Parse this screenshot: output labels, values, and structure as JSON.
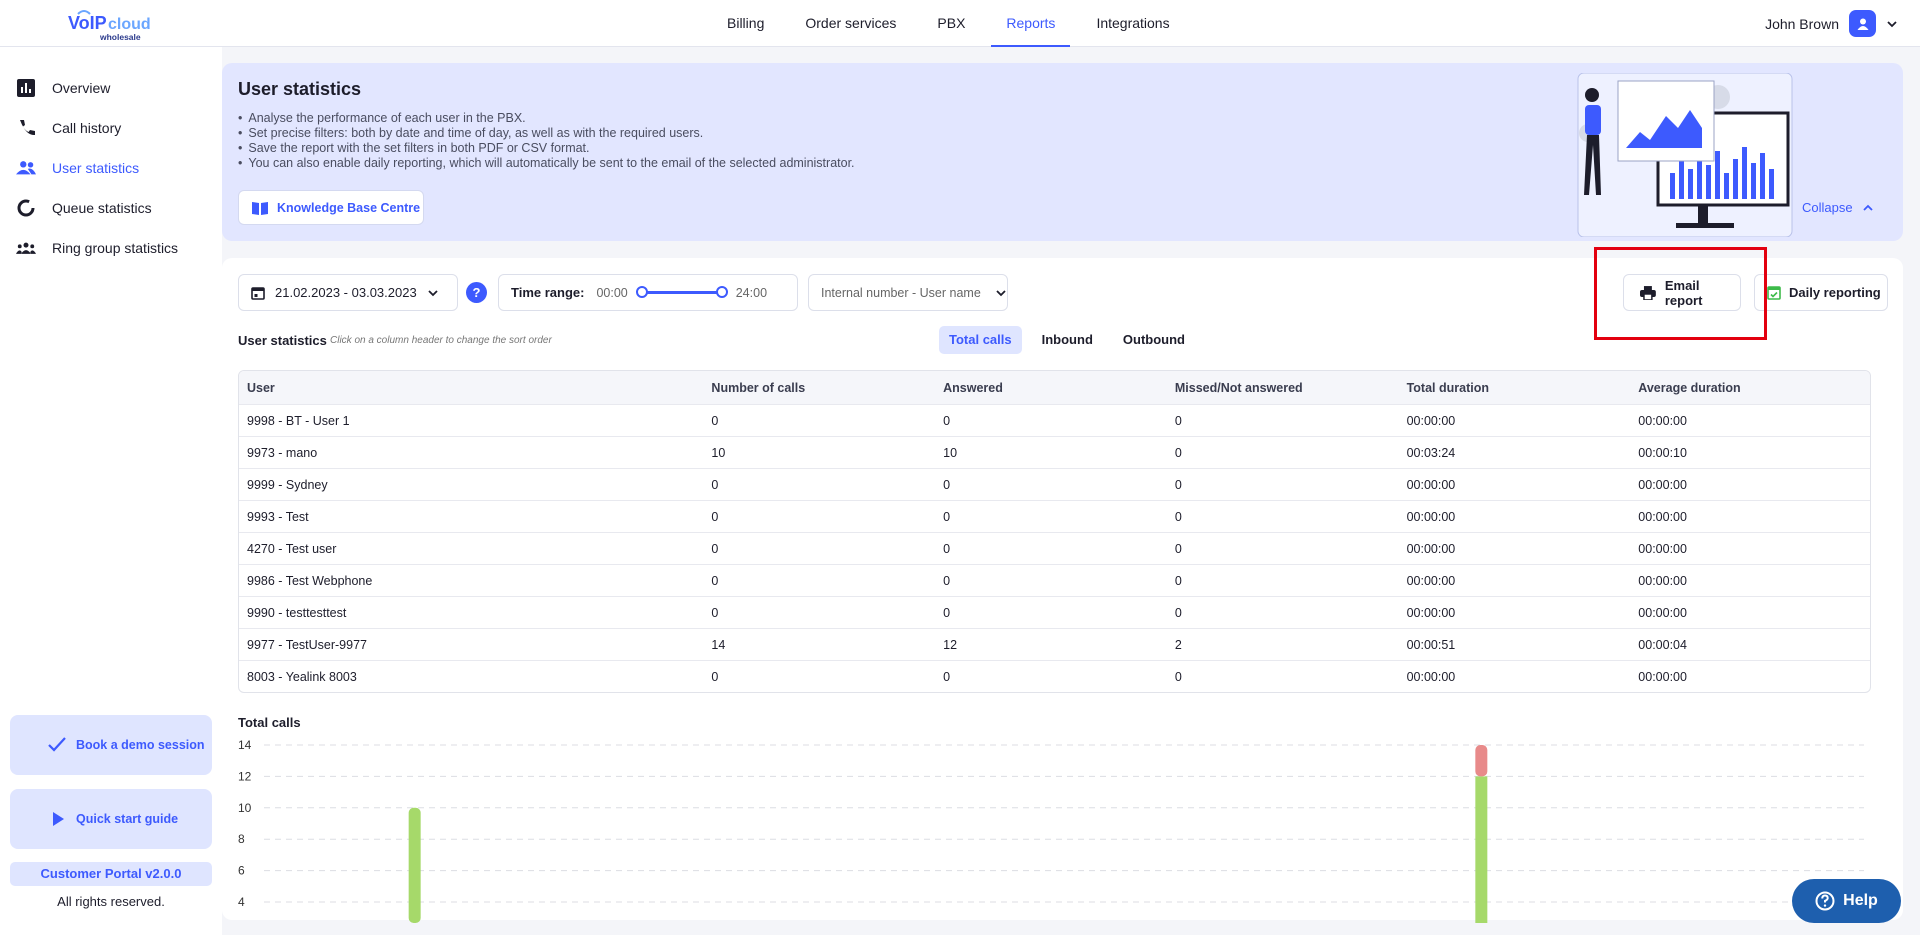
{
  "brand": {
    "logo_main": "VoIPcloud",
    "logo_sub": "wholesale"
  },
  "nav": {
    "items": [
      "Billing",
      "Order services",
      "PBX",
      "Reports",
      "Integrations"
    ],
    "active": "Reports"
  },
  "user": {
    "name": "John Brown"
  },
  "sidebar": {
    "items": [
      {
        "label": "Overview",
        "icon": "bar-chart-icon"
      },
      {
        "label": "Call history",
        "icon": "phone-icon"
      },
      {
        "label": "User statistics",
        "icon": "users-icon",
        "active": true
      },
      {
        "label": "Queue statistics",
        "icon": "donut-icon"
      },
      {
        "label": "Ring group statistics",
        "icon": "group-icon"
      }
    ],
    "demo": "Book a demo session",
    "guide": "Quick start guide",
    "version": "Customer Portal v2.0.0",
    "rights": "All rights reserved."
  },
  "banner": {
    "title": "User statistics",
    "bullets": [
      "Analyse the performance of each user in the PBX.",
      "Set precise filters: both by date and time of day, as well as with the required users.",
      "Save the report with the set filters in both PDF or CSV format.",
      "You can also enable daily reporting, which will automatically be sent to the email of the selected administrator."
    ],
    "kb_button": "Knowledge Base Centre",
    "collapse": "Collapse"
  },
  "filters": {
    "date_range": "21.02.2023 - 03.03.2023",
    "help": "?",
    "time_range_label": "Time range:",
    "time_start": "00:00",
    "time_end": "24:00",
    "user_select": "Internal number - User name",
    "email_report": "Email report",
    "daily_reporting": "Daily reporting"
  },
  "stats": {
    "title": "User statistics",
    "hint": "Click on a column header to change the sort order",
    "tabs": [
      "Total calls",
      "Inbound",
      "Outbound"
    ],
    "active_tab": "Total calls",
    "columns": [
      "User",
      "Number of calls",
      "Answered",
      "Missed/Not answered",
      "Total duration",
      "Average duration"
    ],
    "rows": [
      [
        "9998 - BT - User 1",
        "0",
        "0",
        "0",
        "00:00:00",
        "00:00:00"
      ],
      [
        "9973 - mano",
        "10",
        "10",
        "0",
        "00:03:24",
        "00:00:10"
      ],
      [
        "9999 - Sydney",
        "0",
        "0",
        "0",
        "00:00:00",
        "00:00:00"
      ],
      [
        "9993 - Test",
        "0",
        "0",
        "0",
        "00:00:00",
        "00:00:00"
      ],
      [
        "4270 - Test user",
        "0",
        "0",
        "0",
        "00:00:00",
        "00:00:00"
      ],
      [
        "9986 - Test Webphone",
        "0",
        "0",
        "0",
        "00:00:00",
        "00:00:00"
      ],
      [
        "9990 - testtesttest",
        "0",
        "0",
        "0",
        "00:00:00",
        "00:00:00"
      ],
      [
        "9977 - TestUser-9977",
        "14",
        "12",
        "2",
        "00:00:51",
        "00:00:04"
      ],
      [
        "8003 - Yealink 8003",
        "0",
        "0",
        "0",
        "00:00:00",
        "00:00:00"
      ]
    ]
  },
  "chart_data": {
    "type": "bar",
    "title": "Total calls",
    "categories": [
      "9998 - BT - User 1",
      "9973 - mano",
      "9999 - Sydney",
      "9993 - Test",
      "4270 - Test user",
      "9986 - Test Webphone",
      "9990 - testtesttest",
      "9977 - TestUser-9977",
      "8003 - Yealink 8003"
    ],
    "series": [
      {
        "values": [
          0,
          10,
          0,
          0,
          0,
          0,
          0,
          12,
          0
        ],
        "color": "#a6d96a"
      },
      {
        "values": [
          0,
          0,
          0,
          0,
          0,
          0,
          0,
          2,
          0
        ],
        "color": "#e88a8a"
      }
    ],
    "yticks": [
      14,
      12,
      10,
      8,
      6,
      4
    ],
    "ylim_visible": [
      4,
      14
    ],
    "stacked": true,
    "grid": true
  },
  "help_button": "Help",
  "colors": {
    "accent": "#3d5afe",
    "answered": "#a6d96a",
    "missed": "#e88a8a",
    "highlight": "#e3000f"
  }
}
